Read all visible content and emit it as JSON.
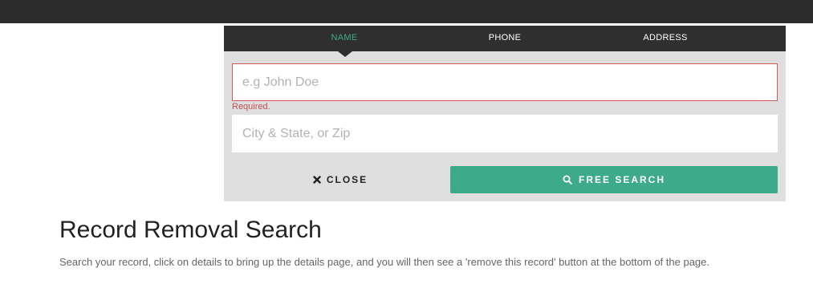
{
  "search_panel": {
    "tabs": [
      {
        "label": "NAME",
        "active": true
      },
      {
        "label": "PHONE",
        "active": false
      },
      {
        "label": "ADDRESS",
        "active": false
      }
    ],
    "name_field": {
      "placeholder": "e.g John Doe",
      "value": "",
      "error": "Required."
    },
    "location_field": {
      "placeholder": "City & State, or Zip",
      "value": ""
    },
    "close_button": {
      "label": "CLOSE",
      "icon": "close-icon"
    },
    "search_button": {
      "label": "FREE SEARCH",
      "icon": "search-icon"
    }
  },
  "page": {
    "title": "Record Removal Search",
    "description": "Search your record, click on details to bring up the details page, and you will then see a 'remove this record' button at the bottom of the page."
  },
  "colors": {
    "accent": "#3daa8a",
    "topbar": "#2c2c2c",
    "error": "#c05050"
  }
}
